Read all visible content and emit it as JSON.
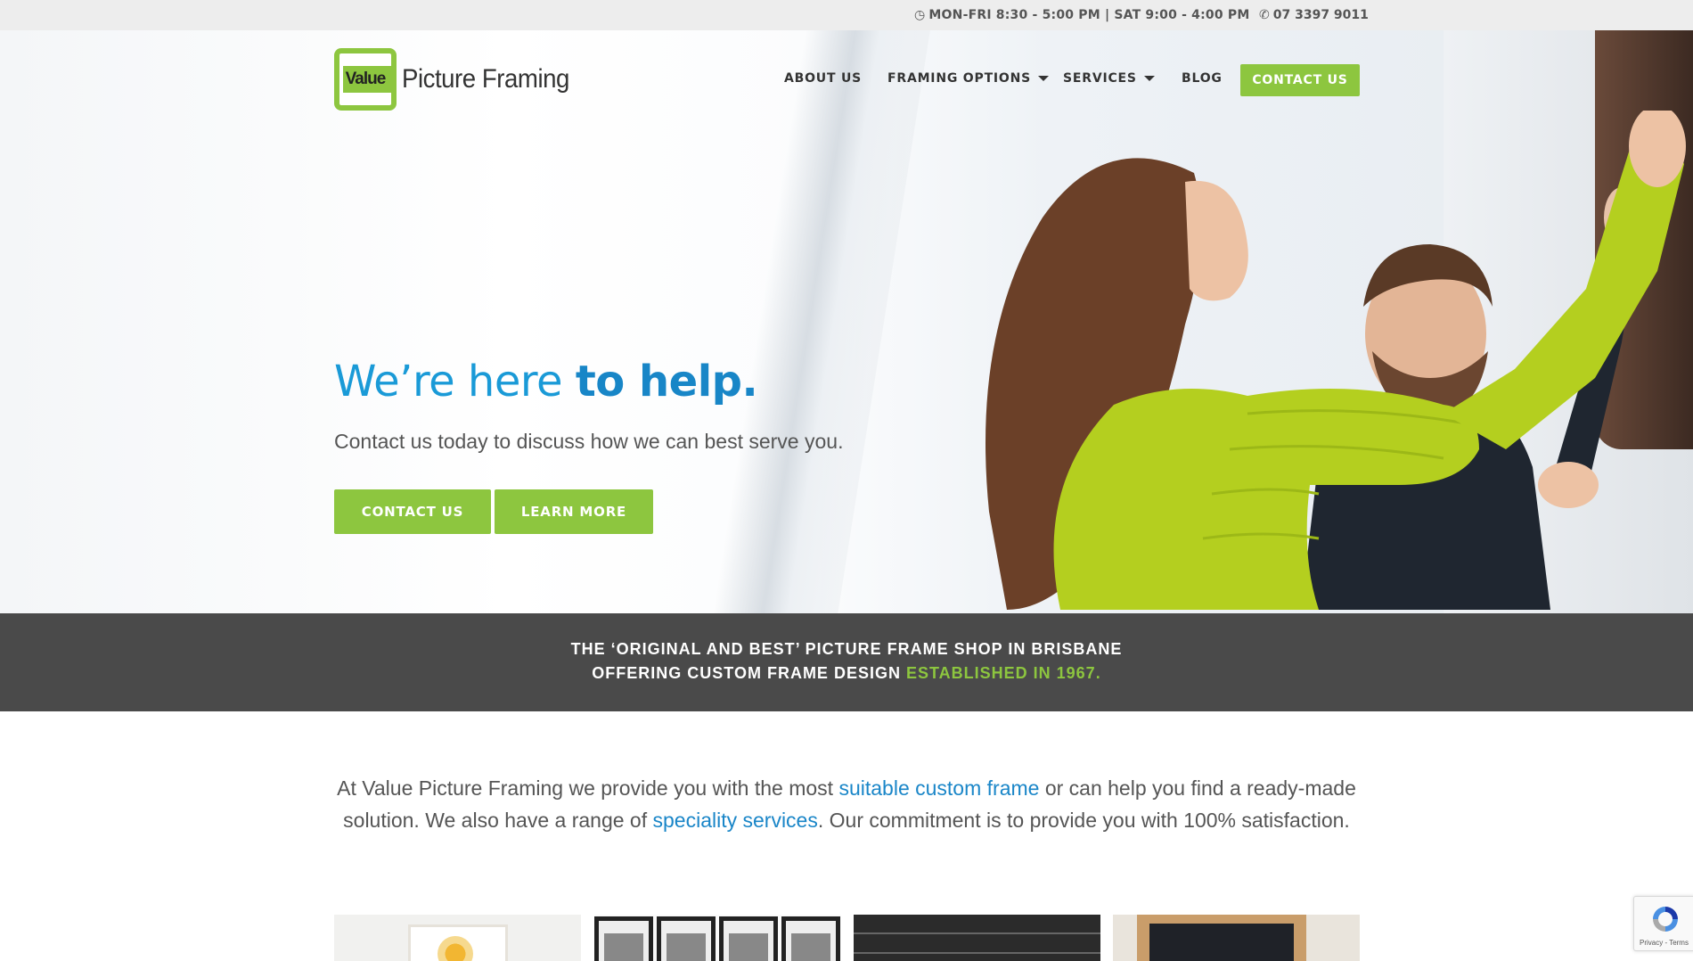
{
  "topbar": {
    "hours": "MON-FRI 8:30 - 5:00 PM | SAT 9:00 - 4:00 PM",
    "phone": "07 3397 9011"
  },
  "brand": {
    "logo_mark": "Value",
    "logo_word": "Picture Framing",
    "green": "#8dc63f",
    "blue": "#1a9ad7"
  },
  "nav": {
    "about": "ABOUT US",
    "framing_options": "FRAMING OPTIONS",
    "services": "SERVICES",
    "blog": "BLOG",
    "contact": "CONTACT US"
  },
  "hero": {
    "headline_light": "We’re here ",
    "headline_bold": "to help.",
    "subline": "Contact us today to discuss how we can best serve you.",
    "btn_contact": "CONTACT US",
    "btn_learn": "LEARN MORE"
  },
  "band": {
    "line1": "THE ‘ORIGINAL AND BEST’ PICTURE FRAME SHOP IN BRISBANE",
    "line2_prefix": "OFFERING CUSTOM FRAME DESIGN ",
    "line2_accent": "ESTABLISHED IN 1967."
  },
  "intro": {
    "t1": "At Value Picture Framing we provide you with the most ",
    "link1": "suitable custom frame",
    "t2": " or can help you find a ready-made solution. We also have a range of ",
    "link2": "speciality services",
    "t3": ". Our commitment is to provide you with 100% satisfaction."
  },
  "recaptcha": {
    "text": "Privacy - Terms"
  },
  "icons": [
    "clock-icon",
    "phone-icon",
    "caret-down-icon",
    "recaptcha-icon"
  ]
}
